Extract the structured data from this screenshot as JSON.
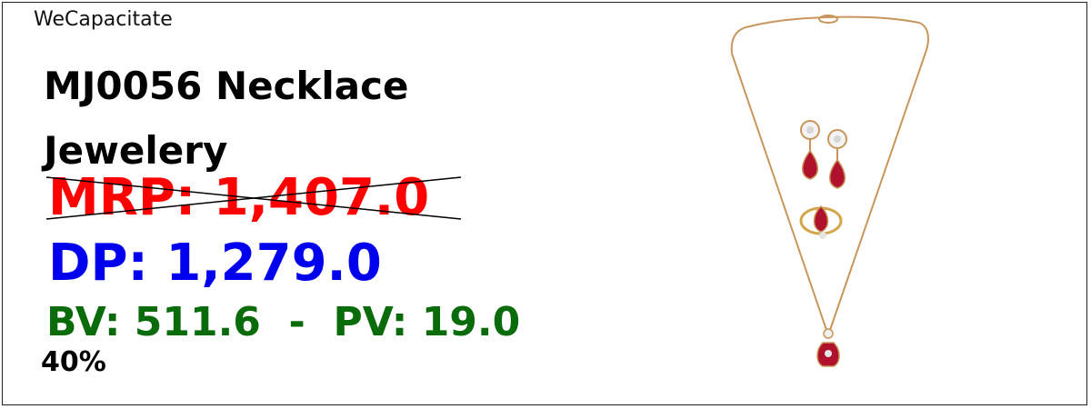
{
  "brand": "WeCapacitate",
  "product": {
    "title": "MJ0056 Necklace Jewelery",
    "image_alt": "Gold chain necklace with ruby pendant, earrings and ring"
  },
  "pricing": {
    "mrp": "MRP: 1,407.0",
    "dp": "DP: 1,279.0",
    "bv_pv": "BV: 511.6  -  PV: 19.0",
    "discount": "40%"
  },
  "colors": {
    "mrp": "#ff0000",
    "dp": "#0000ee",
    "bv_pv": "#0a6b0a",
    "gold": "#c9955b",
    "ruby": "#b0122e"
  }
}
